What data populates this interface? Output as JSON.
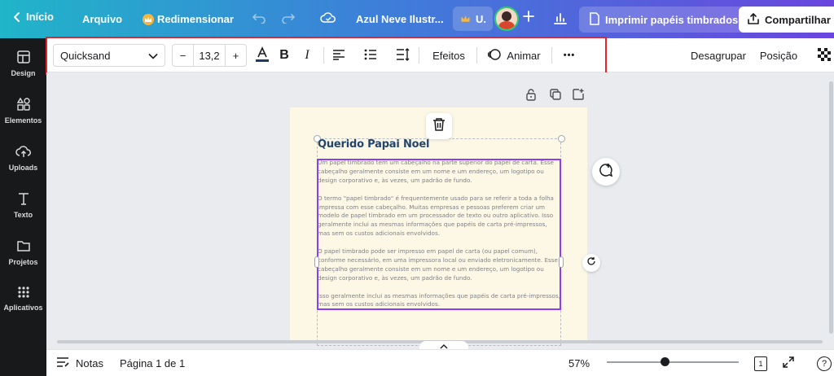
{
  "topbar": {
    "home_label": "Início",
    "file_label": "Arquivo",
    "resize_label": "Redimensionar",
    "doc_title": "Azul Neve Ilustr...",
    "user_initial": "U.",
    "print_label": "Imprimir papéis timbrados",
    "share_label": "Compartilhar"
  },
  "sidebar": {
    "items": [
      {
        "label": "Design"
      },
      {
        "label": "Elementos"
      },
      {
        "label": "Uploads"
      },
      {
        "label": "Texto"
      },
      {
        "label": "Projetos"
      },
      {
        "label": "Aplicativos"
      }
    ]
  },
  "toolbar": {
    "font_name": "Quicksand",
    "font_size": "13,2",
    "minus": "−",
    "plus": "+",
    "bold": "B",
    "italic": "I",
    "effects_label": "Efeitos",
    "animate_label": "Animar",
    "more_label": "•••",
    "ungroup_label": "Desagrupar",
    "position_label": "Posição",
    "text_color": "#1f3b63"
  },
  "document": {
    "title": "Querido Papai Noel",
    "paragraphs": [
      "Um papel timbrado tem um cabeçalho na parte superior do papel de carta. Esse cabeçalho geralmente consiste em um nome e um endereço, um logotipo ou design corporativo e, às vezes, um padrão de fundo.",
      "O termo \"papel timbrado\" é frequentemente usado para se referir a toda a folha impressa com esse cabeçalho. Muitas empresas e pessoas preferem criar um modelo de papel timbrado em um processador de texto ou outro aplicativo. Isso geralmente inclui as mesmas informações que papéis de carta pré-impressos, mas sem os custos adicionais envolvidos.",
      "O papel timbrado pode ser impresso em papel de carta (ou papel comum), conforme necessário, em uma impressora local ou enviado eletronicamente. Esse cabeçalho geralmente consiste em um nome e um endereço, um logotipo ou design corporativo e, às vezes, um padrão de fundo.",
      "Isso geralmente inclui as mesmas informações que papéis de carta pré-impressos, mas sem os custos adicionais envolvidos."
    ]
  },
  "bottombar": {
    "notes_label": "Notas",
    "page_label": "Página 1 de 1",
    "zoom": "57%",
    "zoom_fraction": 0.57,
    "page_count": "1",
    "help": "?"
  },
  "colors": {
    "accent": "#8b3dff",
    "highlight": "#e3262b",
    "sidebar_bg": "#18191b",
    "page_bg": "#fdf8e6",
    "title_color": "#23456e"
  }
}
